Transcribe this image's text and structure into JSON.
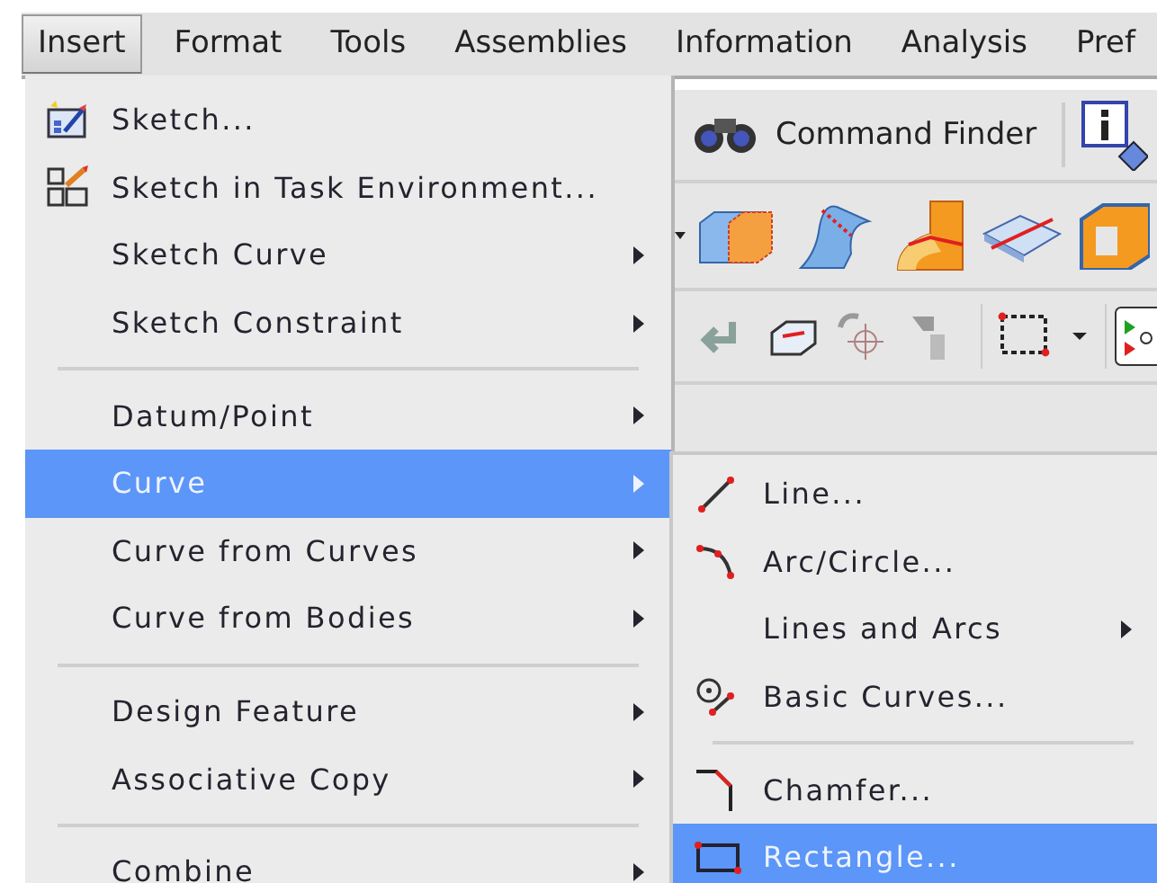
{
  "menubar": [
    {
      "label": "Insert",
      "selected": true
    },
    {
      "label": "Format",
      "selected": false
    },
    {
      "label": "Tools",
      "selected": false
    },
    {
      "label": "Assemblies",
      "selected": false
    },
    {
      "label": "Information",
      "selected": false
    },
    {
      "label": "Analysis",
      "selected": false
    },
    {
      "label": "Pref",
      "selected": false
    }
  ],
  "toolbar": {
    "command_finder": "Command Finder"
  },
  "insert_menu": [
    {
      "kind": "item",
      "label": "Sketch...",
      "submenu": false,
      "selected": false
    },
    {
      "kind": "item",
      "label": "Sketch in Task Environment...",
      "submenu": false,
      "selected": false
    },
    {
      "kind": "item",
      "label": "Sketch Curve",
      "submenu": true,
      "selected": false
    },
    {
      "kind": "item",
      "label": "Sketch Constraint",
      "submenu": true,
      "selected": false
    },
    {
      "kind": "separator"
    },
    {
      "kind": "item",
      "label": "Datum/Point",
      "submenu": true,
      "selected": false
    },
    {
      "kind": "item",
      "label": "Curve",
      "submenu": true,
      "selected": true
    },
    {
      "kind": "item",
      "label": "Curve from Curves",
      "submenu": true,
      "selected": false
    },
    {
      "kind": "item",
      "label": "Curve from Bodies",
      "submenu": true,
      "selected": false
    },
    {
      "kind": "separator"
    },
    {
      "kind": "item",
      "label": "Design Feature",
      "submenu": true,
      "selected": false
    },
    {
      "kind": "item",
      "label": "Associative Copy",
      "submenu": true,
      "selected": false
    },
    {
      "kind": "separator"
    },
    {
      "kind": "item",
      "label": "Combine",
      "submenu": true,
      "selected": false
    }
  ],
  "curve_submenu": [
    {
      "kind": "item",
      "label": "Line...",
      "submenu": false,
      "selected": false
    },
    {
      "kind": "item",
      "label": "Arc/Circle...",
      "submenu": false,
      "selected": false
    },
    {
      "kind": "item",
      "label": "Lines and Arcs",
      "submenu": true,
      "selected": false
    },
    {
      "kind": "item",
      "label": "Basic Curves...",
      "submenu": false,
      "selected": false
    },
    {
      "kind": "separator"
    },
    {
      "kind": "item",
      "label": "Chamfer...",
      "submenu": false,
      "selected": false
    },
    {
      "kind": "item",
      "label": "Rectangle...",
      "submenu": false,
      "selected": true
    }
  ]
}
